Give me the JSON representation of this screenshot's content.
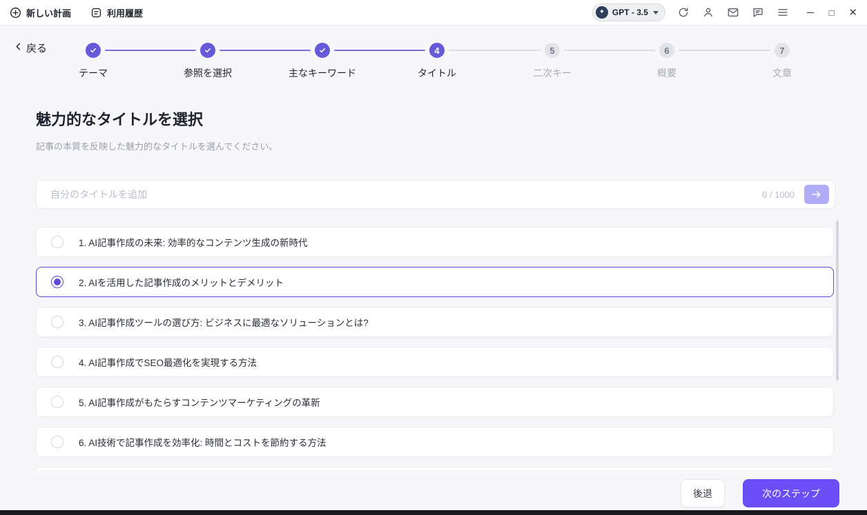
{
  "topbar": {
    "new_plan": "新しい計画",
    "history": "利用履歴",
    "model": "GPT - 3.5"
  },
  "stepper": {
    "back": "戻る",
    "steps": [
      {
        "label": "テーマ",
        "state": "done"
      },
      {
        "label": "参照を選択",
        "state": "done"
      },
      {
        "label": "主なキーワード",
        "state": "done"
      },
      {
        "label": "タイトル",
        "state": "active",
        "number": "4"
      },
      {
        "label": "二次キー",
        "state": "todo",
        "number": "5"
      },
      {
        "label": "概要",
        "state": "todo",
        "number": "6"
      },
      {
        "label": "文章",
        "state": "todo",
        "number": "7"
      }
    ]
  },
  "main": {
    "title": "魅力的なタイトルを選択",
    "subtitle": "記事の本質を反映した魅力的なタイトルを選んでください。",
    "input": {
      "value": "",
      "placeholder": "自分のタイトルを追加",
      "counter": "0 / 1000"
    },
    "options": [
      {
        "label": "1. AI記事作成の未来: 効率的なコンテンツ生成の新時代",
        "selected": false
      },
      {
        "label": "2. AIを活用した記事作成のメリットとデメリット",
        "selected": true
      },
      {
        "label": "3. AI記事作成ツールの選び方: ビジネスに最適なソリューションとは?",
        "selected": false
      },
      {
        "label": "4. AI記事作成でSEO最適化を実現する方法",
        "selected": false
      },
      {
        "label": "5. AI記事作成がもたらすコンテンツマーケティングの革新",
        "selected": false
      },
      {
        "label": "6. AI技術で記事作成を効率化: 時間とコストを節約する方法",
        "selected": false
      }
    ]
  },
  "footer": {
    "back": "後退",
    "next": "次のステップ"
  },
  "colors": {
    "accent": "#6b4ef5",
    "accent_muted": "#aeadf6",
    "step_purple": "#675ad8",
    "line_done": "#7a6ee0",
    "line_todo": "#dcdde2",
    "selected_border": "#5d4ad8",
    "text_dark": "#20242e",
    "text_gray": "#9ba0aa",
    "bg": "#f7f7fa",
    "card_border": "#ececf1"
  }
}
